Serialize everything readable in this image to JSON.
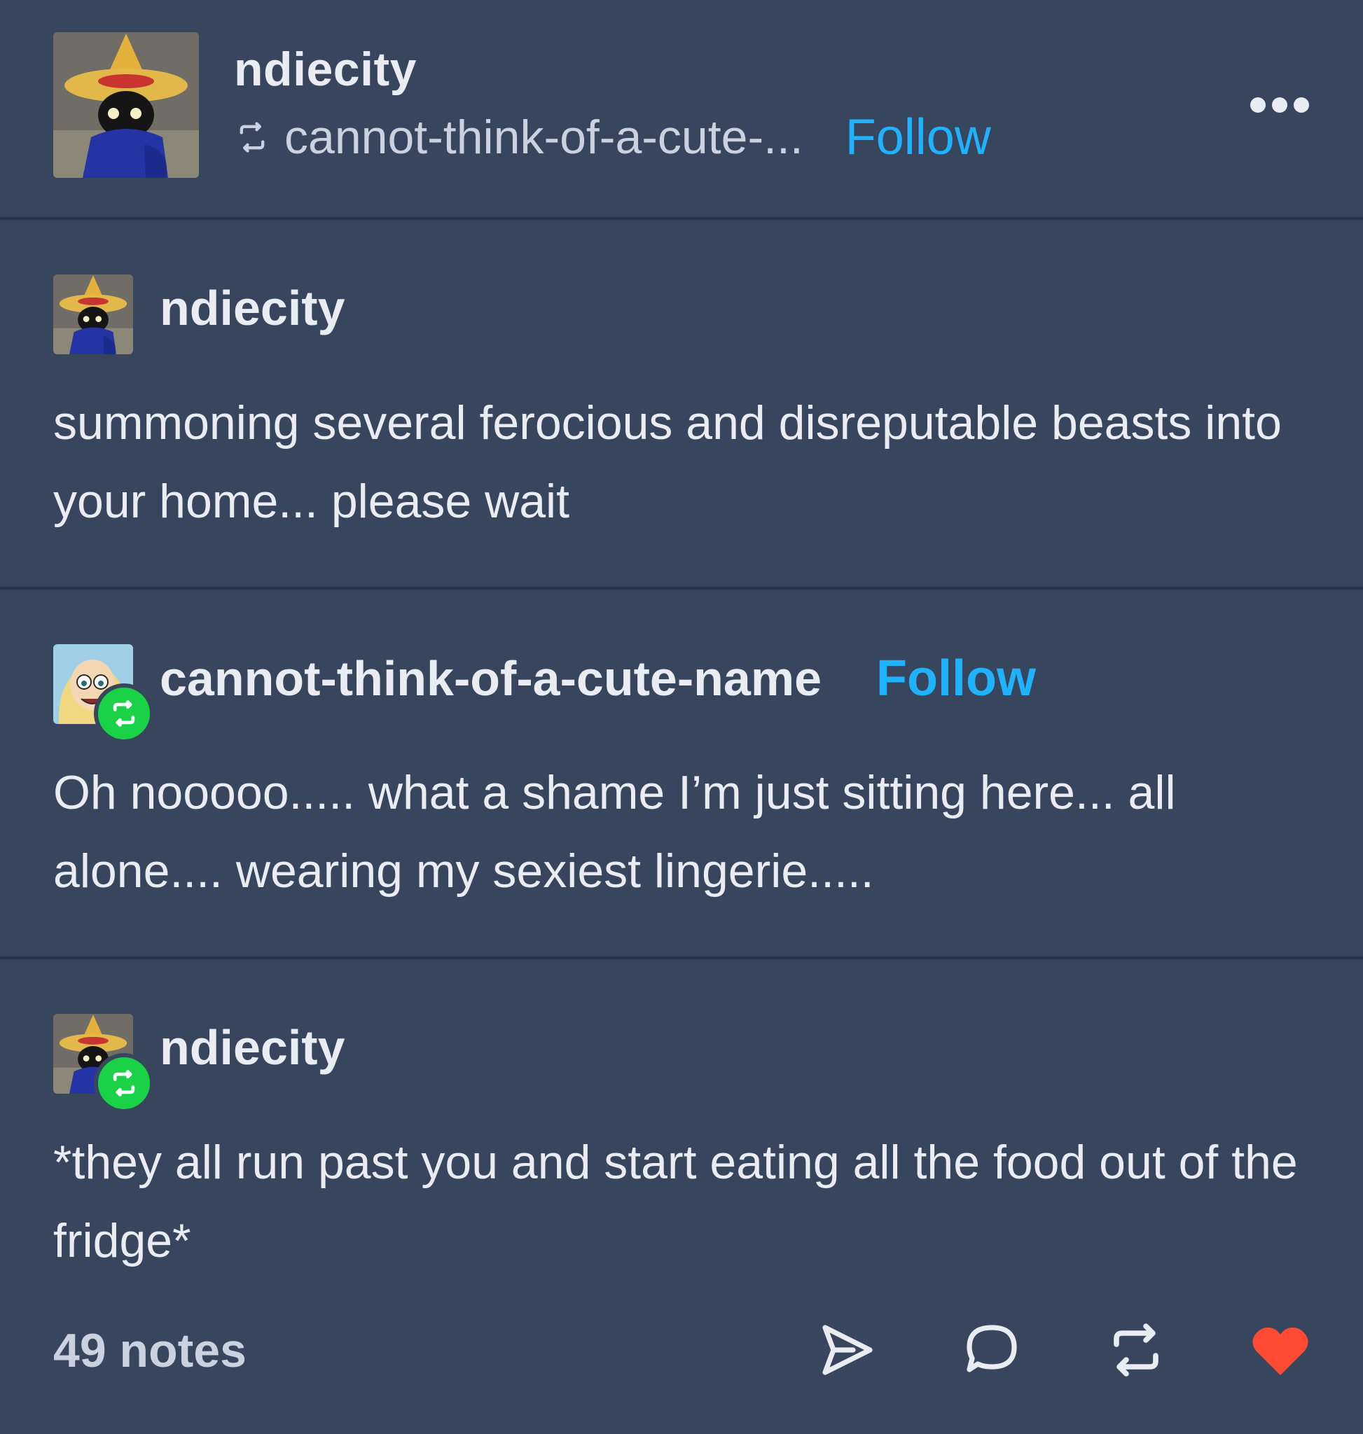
{
  "colors": {
    "background": "#37465d",
    "divider": "#26324a",
    "link": "#1fb3ff",
    "reblog_badge": "#1ad248",
    "heart": "#ff4a34",
    "text": "#e9edf3"
  },
  "header": {
    "username": "ndiecity",
    "reblogged_from": "cannot-think-of-a-cute-...",
    "follow_label": "Follow",
    "more_icon": "more-horizontal-icon"
  },
  "thread": [
    {
      "username": "ndiecity",
      "text": "summoning several ferocious and disreputable beasts into your home... please wait"
    },
    {
      "username": "cannot-think-of-a-cute-name",
      "follow_label": "Follow",
      "text": "Oh nooooo..... what a shame I’m just sitting here... all alone.... wearing my sexiest lingerie....."
    },
    {
      "username": "ndiecity",
      "text": "*they all run past you and start eating all the food out of the fridge*"
    }
  ],
  "footer": {
    "notes": "49 notes",
    "icons": [
      "share-icon",
      "comment-icon",
      "reblog-icon",
      "like-heart-icon"
    ]
  }
}
